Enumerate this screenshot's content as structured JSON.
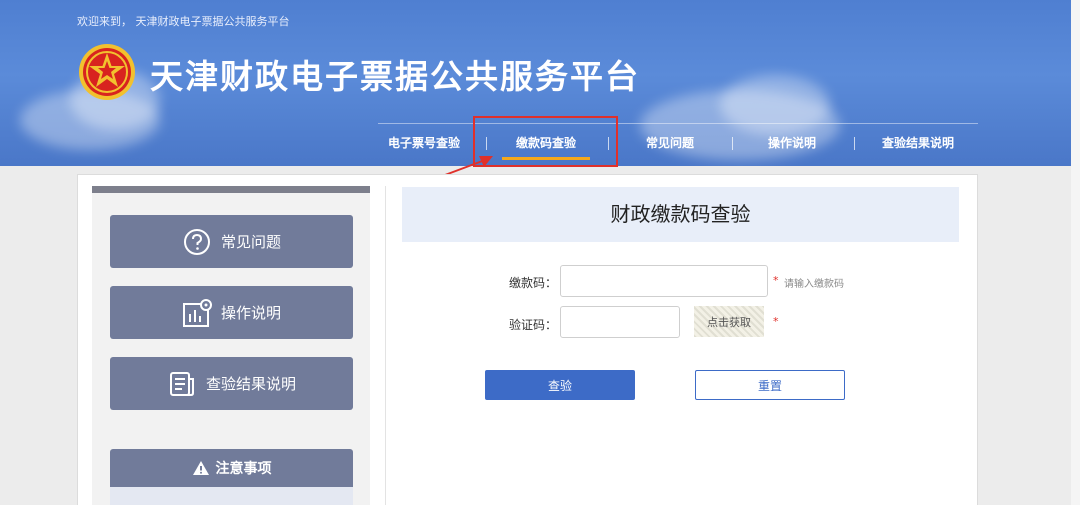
{
  "header": {
    "welcome": "欢迎来到， 天津财政电子票据公共服务平台",
    "title": "天津财政电子票据公共服务平台"
  },
  "nav": {
    "items": [
      {
        "label": "电子票号查验",
        "active": false
      },
      {
        "label": "缴款码查验",
        "active": true
      },
      {
        "label": "常见问题",
        "active": false
      },
      {
        "label": "操作说明",
        "active": false
      },
      {
        "label": "查验结果说明",
        "active": false
      }
    ]
  },
  "sidebar": {
    "items": [
      {
        "label": "常见问题",
        "icon": "question-circle-icon"
      },
      {
        "label": "操作说明",
        "icon": "chart-gear-icon"
      },
      {
        "label": "查验结果说明",
        "icon": "document-icon"
      }
    ],
    "notice": {
      "label": "注意事项",
      "icon": "warning-icon"
    }
  },
  "main": {
    "title": "财政缴款码查验",
    "form": {
      "payment_code_label": "缴款码：",
      "payment_code_value": "",
      "payment_code_hint": "请输入缴款码",
      "captcha_label": "验证码：",
      "captcha_value": "",
      "captcha_button": "点击获取",
      "required_mark": "*"
    },
    "buttons": {
      "submit": "查验",
      "reset": "重置"
    }
  },
  "colors": {
    "header_blue": "#4f7fd1",
    "active_underline": "#f4a81b",
    "highlight_red": "#e0302a",
    "sidebar_button": "#717b9a",
    "primary_button": "#3d6bc7"
  }
}
